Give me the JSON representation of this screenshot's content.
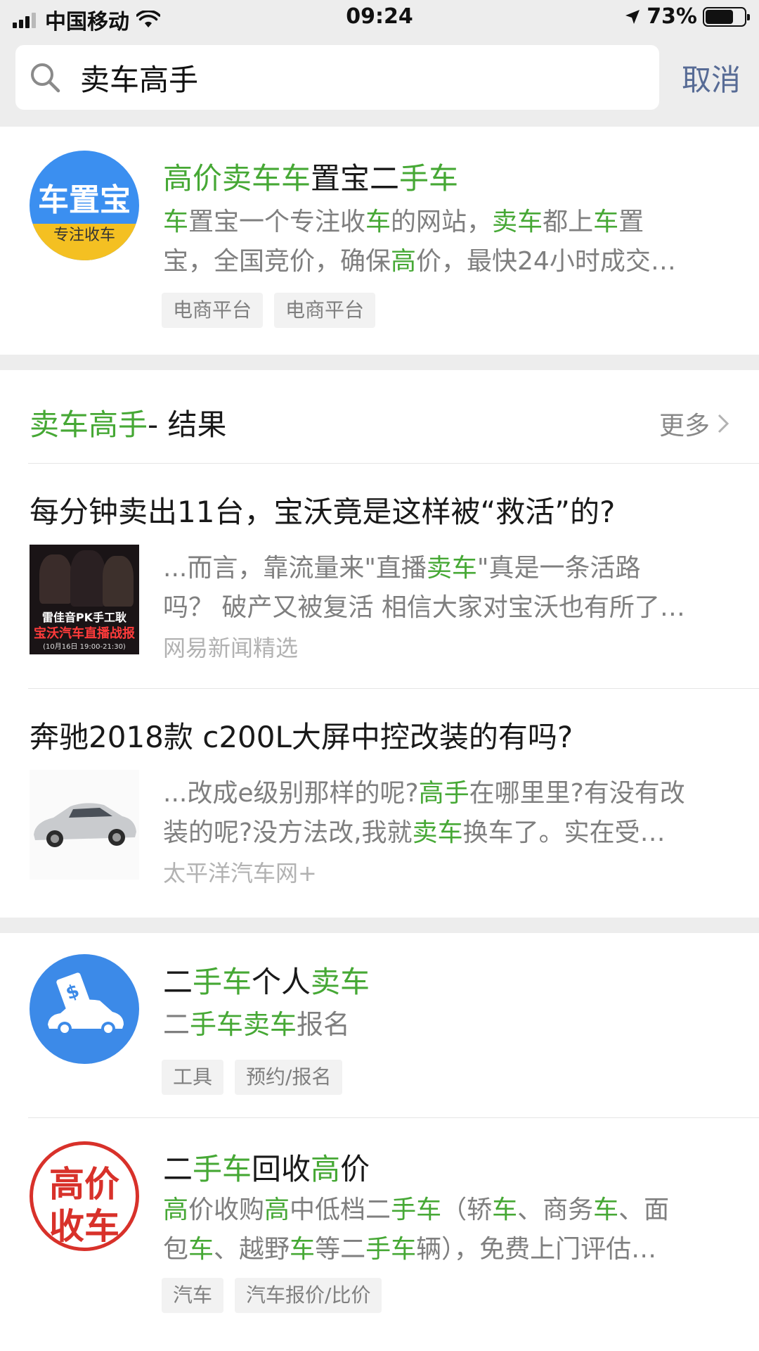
{
  "status": {
    "carrier": "中国移动",
    "time": "09:24",
    "battery": "73%",
    "battery_level": 0.73
  },
  "search": {
    "query": "卖车高手",
    "cancel": "取消"
  },
  "top_result": {
    "logo": {
      "line1": "车置宝",
      "line2": "专注收车",
      "bg": "#3b8ff0",
      "band": "#f4c022"
    },
    "title": [
      [
        "高价",
        true
      ],
      [
        "卖车车",
        true
      ],
      [
        "置宝二",
        false
      ],
      [
        "手车",
        true
      ]
    ],
    "desc_line1": [
      [
        "车",
        true
      ],
      [
        "置宝一个专注收",
        false
      ],
      [
        "车",
        true
      ],
      [
        "的网站，",
        false
      ],
      [
        "卖车",
        true
      ],
      [
        "都上",
        false
      ],
      [
        "车",
        true
      ],
      [
        "置",
        false
      ]
    ],
    "desc_line2": [
      [
        "宝，全国竞价，确保",
        false
      ],
      [
        "高",
        true
      ],
      [
        "价，最快24小时成交…",
        false
      ]
    ],
    "tags": [
      "电商平台",
      "电商平台"
    ]
  },
  "articles": {
    "header": [
      [
        "卖车高手",
        true
      ],
      [
        "- 结果",
        false
      ]
    ],
    "more": "更多",
    "items": [
      {
        "title": "每分钟卖出11台，宝沃竟是这样被“救活”的?",
        "thumb_caption1": "雷佳音PK手工耿",
        "thumb_caption2": "宝沃汽车直播战报",
        "thumb_caption3": "(10月16日 19:00-21:30)",
        "desc_line1": [
          [
            "...而言，靠流量来\"直播",
            false
          ],
          [
            "卖车",
            true
          ],
          [
            "\"真是一条活路",
            false
          ]
        ],
        "desc_line2": [
          [
            "吗？ 破产又被复活 相信大家对宝沃也有所了…",
            false
          ]
        ],
        "source": "网易新闻精选"
      },
      {
        "title": "奔驰2018款 c200L大屏中控改装的有吗?",
        "desc_line1": [
          [
            "...改成e级别那样的呢?",
            false
          ],
          [
            "高手",
            true
          ],
          [
            "在哪里里?有没有改",
            false
          ]
        ],
        "desc_line2": [
          [
            "装的呢?没方法改,我就",
            false
          ],
          [
            "卖车",
            true
          ],
          [
            "换车了。实在受…",
            false
          ]
        ],
        "source": "太平洋汽车网+"
      }
    ]
  },
  "apps": [
    {
      "title": [
        [
          "二",
          false
        ],
        [
          "手车",
          true
        ],
        [
          "个人",
          false
        ],
        [
          "卖车",
          true
        ]
      ],
      "desc": [
        [
          "二",
          false
        ],
        [
          "手车卖车",
          true
        ],
        [
          "报名",
          false
        ]
      ],
      "tags": [
        "工具",
        "预约/报名"
      ],
      "bg": "#3c8ae8"
    },
    {
      "logo_line1": "高价",
      "logo_line2": "收车",
      "logo_color": "#d8312a",
      "title": [
        [
          "二",
          false
        ],
        [
          "手车",
          true
        ],
        [
          "回收",
          false
        ],
        [
          "高",
          true
        ],
        [
          "价",
          false
        ]
      ],
      "desc_line1": [
        [
          "高",
          true
        ],
        [
          "价收购",
          false
        ],
        [
          "高",
          true
        ],
        [
          "中低档二",
          false
        ],
        [
          "手车",
          true
        ],
        [
          "（轿",
          false
        ],
        [
          "车",
          true
        ],
        [
          "、商务",
          false
        ],
        [
          "车",
          true
        ],
        [
          "、面",
          false
        ]
      ],
      "desc_line2": [
        [
          "包",
          false
        ],
        [
          "车",
          true
        ],
        [
          "、越野",
          false
        ],
        [
          "车",
          true
        ],
        [
          "等二",
          false
        ],
        [
          "手车",
          true
        ],
        [
          "辆），免费上门评估…",
          false
        ]
      ],
      "tags": [
        "汽车",
        "汽车报价/比价"
      ]
    }
  ],
  "colors": {
    "highlight": "#46a835",
    "link": "#576b95",
    "background": "#ededed"
  },
  "icons": [
    "signal-icon",
    "wifi-icon",
    "location-arrow-icon",
    "battery-icon",
    "search-icon",
    "chevron-right-icon",
    "car-icon"
  ]
}
